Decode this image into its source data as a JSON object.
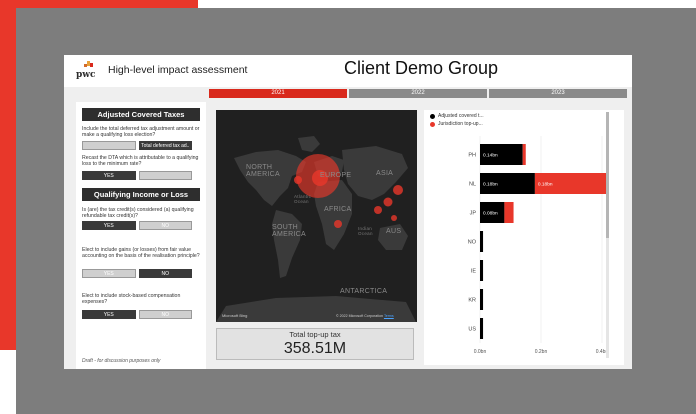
{
  "header": {
    "logo_text": "pwc",
    "title": "High-level impact assessment",
    "client": "Client Demo Group"
  },
  "years": [
    {
      "label": "2021",
      "active": true
    },
    {
      "label": "2022",
      "active": false
    },
    {
      "label": "2023",
      "active": false
    }
  ],
  "adjusted_covered_taxes": {
    "heading": "Adjusted Covered Taxes",
    "q1": "Include the total deferred tax adjustment amount or make a qualifying loss election?",
    "q1_options": [
      "",
      "Total deferred tax ad.."
    ],
    "q2": "Recast the DTA which is attributable to a qualifying loss to the minimum rate?",
    "q2_options": [
      "YES",
      ""
    ]
  },
  "qualifying_income": {
    "heading": "Qualifying Income or Loss",
    "q1": "Is (are) the tax credit(s) considered (a) qualifying refundable tax credit(s)?",
    "q1_options": [
      "YES",
      "NO"
    ],
    "q2": "Elect to include gains (or losses) from fair value accounting on the basis of the realisation principle?",
    "q2_options": [
      "YES",
      "NO"
    ],
    "q3": "Elect to include stock-based compensation expenses?",
    "q3_options": [
      "YES",
      "NO"
    ]
  },
  "draft_note": "Draft - for discussion purposes only",
  "map": {
    "labels": {
      "north_america": "NORTH\nAMERICA",
      "europe": "EUROPE",
      "asia": "ASIA",
      "africa": "AFRICA",
      "south_america": "SOUTH\nAMERICA",
      "australia": "AUS",
      "antarctica": "ANTARCTICA",
      "atlantic": "Atlantic\nOcean",
      "indian": "Indian\nOcean"
    },
    "bing_logo": "Microsoft Bing",
    "copyright": "© 2022 Microsoft Corporation",
    "terms": "Terms",
    "bubble_color": "#e8372a"
  },
  "kpi": {
    "label": "Total top-up tax",
    "value": "358.51M"
  },
  "legend": [
    {
      "label": "Adjusted covered t...",
      "color": "#000000"
    },
    {
      "label": "Jurisdiction top-up...",
      "color": "#e8372a"
    }
  ],
  "chart_data": {
    "type": "bar",
    "orientation": "horizontal",
    "stacked": true,
    "categories": [
      "PH",
      "NL",
      "JP",
      "NO",
      "IE",
      "KR",
      "US"
    ],
    "series": [
      {
        "name": "Adjusted covered t...",
        "color": "#000000",
        "values": [
          0.14,
          0.18,
          0.08,
          0.01,
          0.01,
          0.01,
          0.01
        ],
        "labels": [
          "0.14bn",
          "0.18bn",
          "0.08bn",
          "",
          "",
          "",
          ""
        ]
      },
      {
        "name": "Jurisdiction top-up...",
        "color": "#e8372a",
        "values": [
          0.01,
          0.28,
          0.03,
          0,
          0,
          0,
          0
        ],
        "labels": [
          "",
          "0.18bn",
          "",
          "",
          "",
          "",
          ""
        ]
      }
    ],
    "xlim": [
      0,
      0.4
    ],
    "xticks": [
      "0.0bn",
      "0.2bn",
      "0.4bn"
    ],
    "grid": true
  }
}
